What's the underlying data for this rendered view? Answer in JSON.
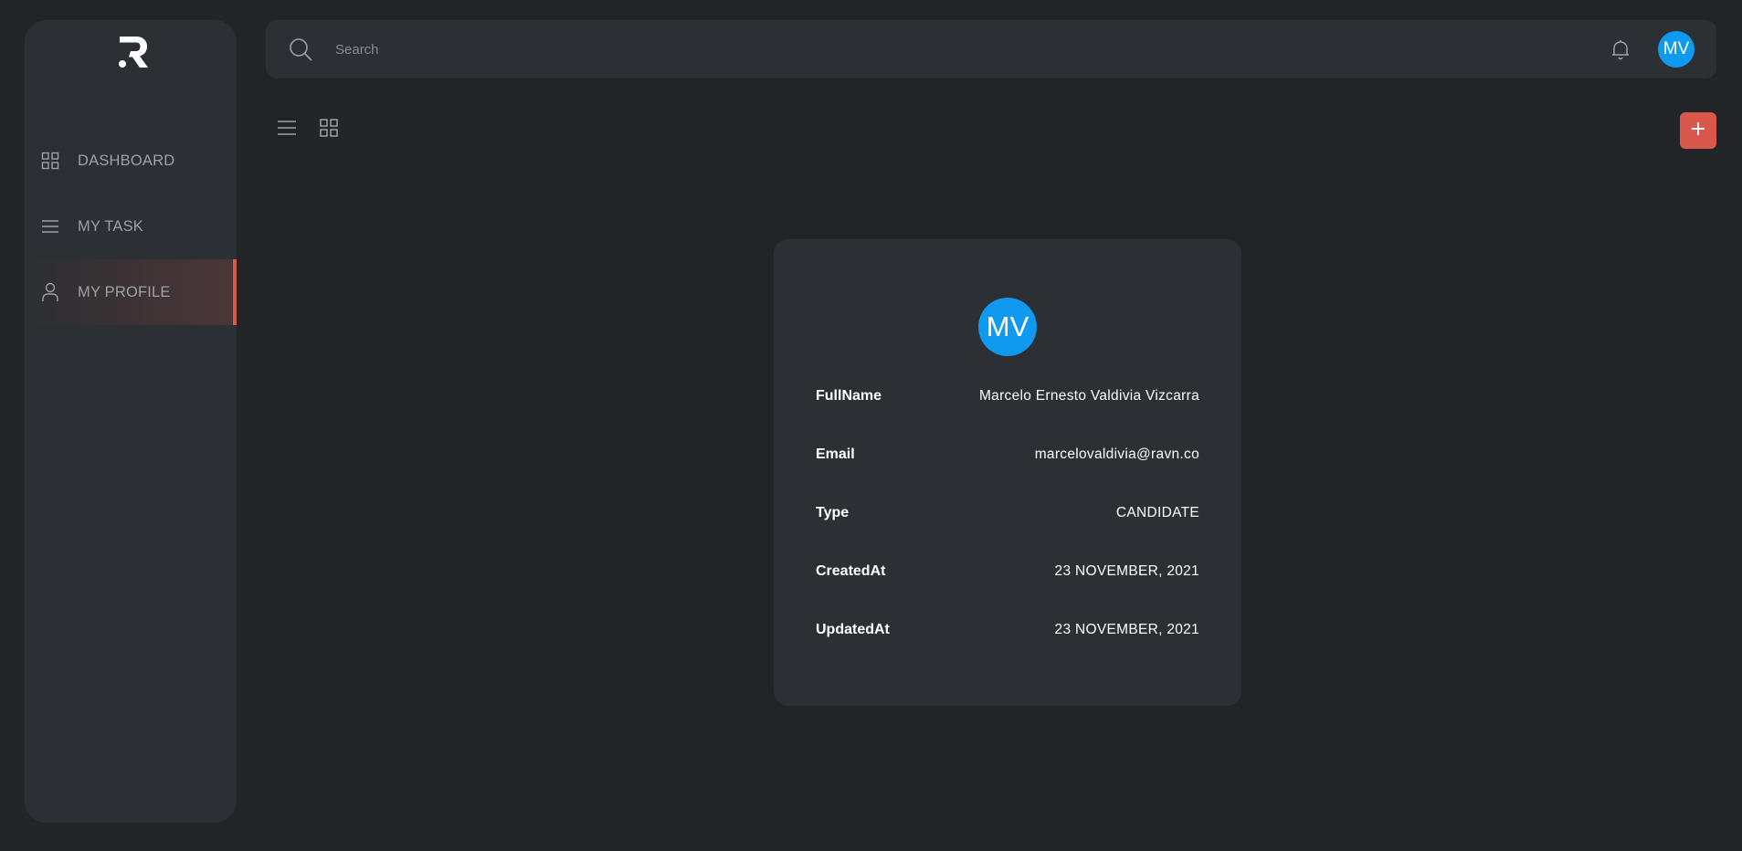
{
  "app": {
    "logo_letter": "R"
  },
  "sidebar": {
    "items": [
      {
        "label": "DASHBOARD",
        "icon": "grid-icon"
      },
      {
        "label": "MY TASK",
        "icon": "list-icon"
      },
      {
        "label": "MY PROFILE",
        "icon": "user-icon",
        "active": true
      }
    ]
  },
  "header": {
    "search_placeholder": "Search",
    "avatar_initials": "MV"
  },
  "toolbar": {
    "add_label": "+"
  },
  "profile": {
    "avatar_initials": "MV",
    "fields": [
      {
        "label": "FullName",
        "value": "Marcelo Ernesto Valdivia Vizcarra"
      },
      {
        "label": "Email",
        "value": "marcelovaldivia@ravn.co"
      },
      {
        "label": "Type",
        "value": "CANDIDATE"
      },
      {
        "label": "CreatedAt",
        "value": "23 NOVEMBER, 2021"
      },
      {
        "label": "UpdatedAt",
        "value": "23 NOVEMBER, 2021"
      }
    ]
  },
  "colors": {
    "background": "#222528",
    "surface": "#2c2f33",
    "accent": "#da584b",
    "avatar": "#0f9af0"
  }
}
